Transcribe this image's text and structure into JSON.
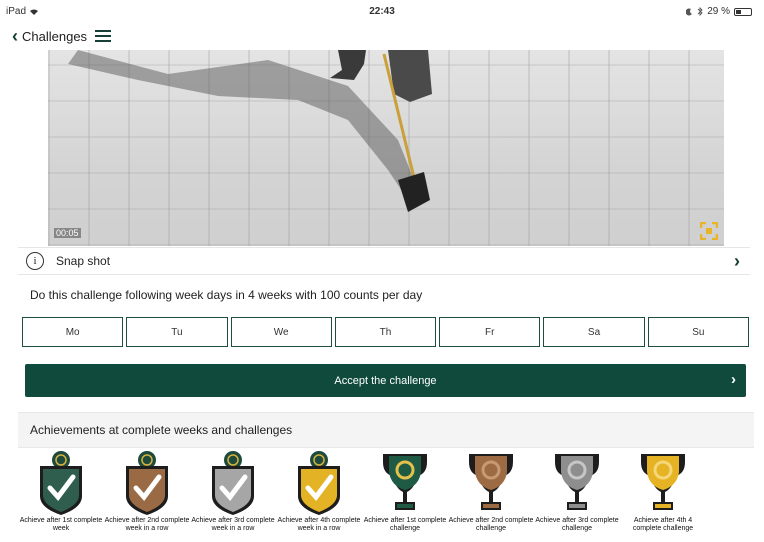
{
  "status": {
    "device": "iPad",
    "time": "22:43",
    "battery": "29 %"
  },
  "nav": {
    "back_label": "Challenges"
  },
  "video": {
    "timestamp": "00:05"
  },
  "snapshot": {
    "label": "Snap shot"
  },
  "description": "Do this challenge following week days in 4 weeks with 100 counts per day",
  "days": [
    "Mo",
    "Tu",
    "We",
    "Th",
    "Fr",
    "Sa",
    "Su"
  ],
  "accept_label": "Accept the challenge",
  "achievements": {
    "title": "Achievements at complete weeks and challenges",
    "items": [
      {
        "caption": "Achieve after 1st complete week",
        "kind": "shield",
        "color": "#2f5e4f"
      },
      {
        "caption": "Achieve after 2nd complete week in a row",
        "kind": "shield",
        "color": "#9a6a45"
      },
      {
        "caption": "Achieve after 3rd complete week in a row",
        "kind": "shield",
        "color": "#a6a6a6"
      },
      {
        "caption": "Achieve after 4th complete week in a row",
        "kind": "shield",
        "color": "#e3b325"
      },
      {
        "caption": "Achieve after 1st complete challenge",
        "kind": "trophy",
        "color": "#1f5a45"
      },
      {
        "caption": "Achieve after 2nd complete challenge",
        "kind": "trophy",
        "color": "#9c6a43"
      },
      {
        "caption": "Achieve after 3rd complete challenge",
        "kind": "trophy",
        "color": "#8e8e8e"
      },
      {
        "caption": "Achieve after 4th 4 complete challenge",
        "kind": "trophy",
        "color": "#e5b323"
      }
    ]
  }
}
